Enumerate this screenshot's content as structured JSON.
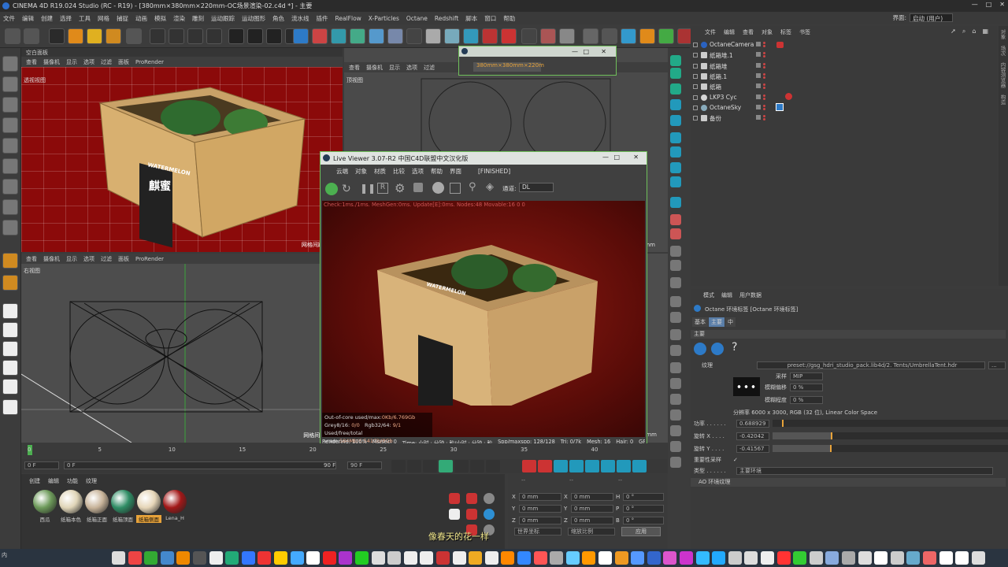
{
  "window": {
    "title": "CINEMA 4D R19.024 Studio (RC - R19) - [380mm×380mm×220mm-OC场景渲染-02.c4d *] - 主要"
  },
  "menu": [
    "文件",
    "编辑",
    "创建",
    "选择",
    "工具",
    "网格",
    "捕捉",
    "动画",
    "模拟",
    "渲染",
    "雕刻",
    "运动跟踪",
    "运动图形",
    "角色",
    "流水线",
    "插件",
    "RealFlow",
    "X-Particles",
    "Octane",
    "Redshift",
    "脚本",
    "窗口",
    "帮助"
  ],
  "layout": {
    "label": "界面:",
    "value": "启动 (用户)"
  },
  "viewports": {
    "menu": [
      "查看",
      "摄像机",
      "显示",
      "选项",
      "过滤",
      "面板",
      "ProRender"
    ],
    "top_left_tab": "空白面板",
    "persp": {
      "label": "透视视图",
      "grid": "网格间距 : 100"
    },
    "top": {
      "label": "顶视图"
    },
    "right": {
      "label": "右视图",
      "grid": "网格间距 : 10"
    },
    "mm": "mm"
  },
  "floating": {
    "tab": "380mm×380mm×220m"
  },
  "live_viewer": {
    "title": "Live Viewer 3.07-R2 中国C4D联盟中文汉化版",
    "menu": [
      "云端",
      "对象",
      "材质",
      "比较",
      "选项",
      "帮助",
      "界面"
    ],
    "status": "[FINISHED]",
    "channel_label": "通道:",
    "channel_value": "DL",
    "info": "Check:1ms./1ms. MeshGen:0ms. Update[E]:0ms. Nodes:48 Movable:16  0 0",
    "stats": {
      "row1_label": "Out-of-core used/max:",
      "row1_value": "0Kb/6.769Gb",
      "row2_a": "Grey8/16:",
      "row2_av": "0/0",
      "row2_b": "Rgb32/64:",
      "row2_bv": "9/1",
      "row3_label": "Used/free/total vram:",
      "row3_value": "584Mb/6.541Gb/8Gb"
    },
    "statusbar": {
      "rendering": "Rendering: 100%",
      "ms": "Ms/sec: 0",
      "time": "Time: 小时 : 分钟 : 秒/小时 : 分钟 : 秒",
      "spp": "Spp/maxspp: 128/128",
      "tri": "Tri: 0/7k",
      "mesh": "Mesh: 16",
      "hair": "Hair: 0",
      "gp": "GP"
    },
    "box_text": "WATERMELON"
  },
  "box_text": {
    "brand": "WATERMELON",
    "chinese": "麒蜜"
  },
  "timeline": {
    "ticks": [
      "0",
      "5",
      "10",
      "15",
      "20",
      "25",
      "30",
      "35",
      "40"
    ],
    "tick_values": [
      0,
      5,
      10,
      15,
      20,
      25,
      30,
      35,
      40
    ],
    "start": "0 F",
    "cur": "0 F",
    "end_a": "90 F",
    "end_b": "90 F"
  },
  "materials": {
    "menu": [
      "创建",
      "编辑",
      "功能",
      "纹理"
    ],
    "items": [
      {
        "label": "西瓜",
        "color": "#6d9a5a"
      },
      {
        "label": "纸箱本色",
        "color": "#e0d5b8"
      },
      {
        "label": "纸箱正面",
        "color": "#c8b49a"
      },
      {
        "label": "纸箱顶面",
        "color": "#2f8d65"
      },
      {
        "label": "纸箱侧面",
        "color": "#e6d6b8"
      },
      {
        "label": "Lena_H",
        "color": "#a21818"
      }
    ]
  },
  "coords": {
    "header_a": "--",
    "header_b": "--",
    "header_c": "--",
    "rows": [
      {
        "axis": "X",
        "pos": "0 mm",
        "size": "0 mm",
        "rot_label": "H",
        "rot": "0 °"
      },
      {
        "axis": "Y",
        "pos": "0 mm",
        "size": "0 mm",
        "rot_label": "P",
        "rot": "0 °"
      },
      {
        "axis": "Z",
        "pos": "0 mm",
        "size": "0 mm",
        "rot_label": "B",
        "rot": "0 °"
      }
    ],
    "world": "世界坐标",
    "scale": "缩放比例",
    "apply": "应用"
  },
  "subtitle": "像春天的花一样",
  "objects": {
    "menu": [
      "文件",
      "编辑",
      "查看",
      "对象",
      "标签",
      "书签"
    ],
    "items": [
      {
        "name": "OctaneCamera",
        "icon": "camera"
      },
      {
        "name": "纸箱堆.1",
        "icon": "null"
      },
      {
        "name": "纸箱堆",
        "icon": "null"
      },
      {
        "name": "纸箱.1",
        "icon": "null"
      },
      {
        "name": "纸箱",
        "icon": "null"
      },
      {
        "name": "LKP3 Cyc",
        "icon": "cyc"
      },
      {
        "name": "OctaneSky",
        "icon": "sky"
      },
      {
        "name": "备份",
        "icon": "null"
      }
    ]
  },
  "right_vertical_tabs": [
    "对象",
    "场次",
    "内容浏览器",
    "构造"
  ],
  "attributes": {
    "menu": [
      "模式",
      "编辑",
      "用户数据"
    ],
    "title": "Octane 环境标签 [Octane 环境标签]",
    "tabs": [
      "基本",
      "主要",
      "中"
    ],
    "section": "主要",
    "texture_label": "纹理",
    "texture_path": "preset://gsg_hdri_studio_pack.lib4d/2. Tents/UmbrellaTent.hdr",
    "sampling_label": "采样",
    "sampling_value": "MIP",
    "blur_offset_label": "模糊偏移",
    "blur_offset_value": "0 %",
    "blur_amount_label": "模糊程度",
    "blur_amount_value": "0 %",
    "resolution": "分辨率 6000 x 3000, RGB (32 位), Linear Color Space",
    "power_label": "功率 . . . . . .",
    "power_value": "0.688929",
    "rotx_label": "旋转 X . . . .",
    "rotx_value": "-0.42042",
    "roty_label": "旋转 Y . . . .",
    "roty_value": "-0.41567",
    "importance_label": "重要性采样",
    "importance_value": "✓",
    "type_label": "类型 . . . . . .",
    "type_value": "主要环境",
    "ao_label": "AO 环境纹理"
  },
  "taskbar": {
    "start_label": "内"
  },
  "colors": {
    "accent": "#6fbf5a",
    "red_floor": "#8b0a0a",
    "ui_bg": "#3b3b3b",
    "orange": "#e8a33a"
  }
}
